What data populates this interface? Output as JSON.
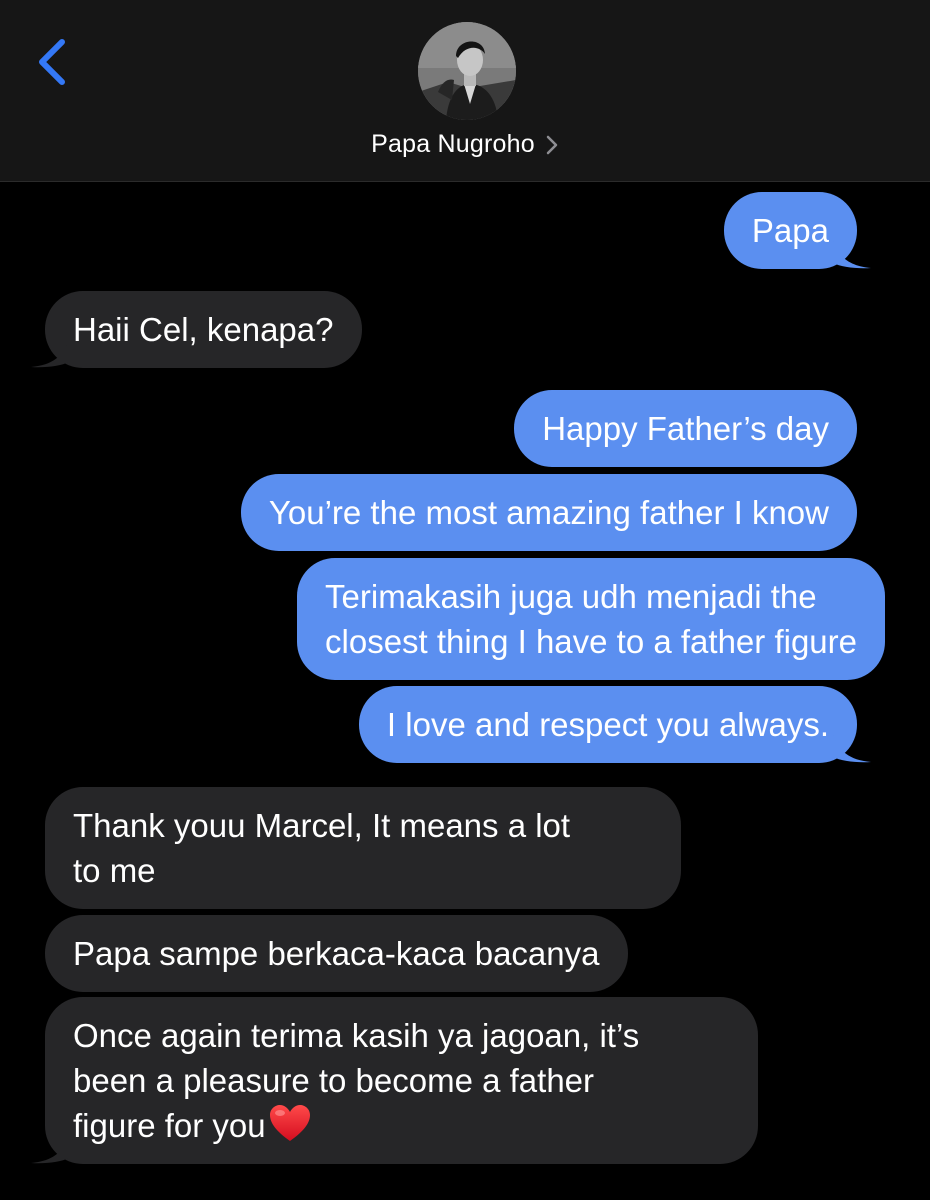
{
  "header": {
    "back_icon": "chevron-left-icon",
    "contact_name": "Papa Nugroho",
    "contact_chevron_icon": "chevron-right-icon",
    "accent_color": "#3478f6"
  },
  "thread": {
    "sent_color": "#5b8ff0",
    "received_color": "#262628",
    "messages": [
      {
        "direction": "sent",
        "lines": [
          "Papa"
        ]
      },
      {
        "direction": "received",
        "lines": [
          "Haii Cel, kenapa?"
        ]
      },
      {
        "direction": "sent",
        "lines": [
          "Happy Father’s day"
        ]
      },
      {
        "direction": "sent",
        "lines": [
          "You’re the most amazing father I know"
        ]
      },
      {
        "direction": "sent",
        "lines": [
          "Terimakasih juga udh menjadi the",
          "closest thing I have to a father figure"
        ]
      },
      {
        "direction": "sent",
        "lines": [
          "I love and respect you always."
        ]
      },
      {
        "direction": "received",
        "lines": [
          "Thank youu Marcel, It means a lot",
          "to me"
        ]
      },
      {
        "direction": "received",
        "lines": [
          "Papa sampe berkaca-kaca bacanya"
        ]
      },
      {
        "direction": "received",
        "lines": [
          "Once again terima kasih ya jagoan, it’s",
          "been a pleasure to become a father",
          "figure for you"
        ],
        "trailing_icon": "red-heart-icon"
      }
    ]
  }
}
